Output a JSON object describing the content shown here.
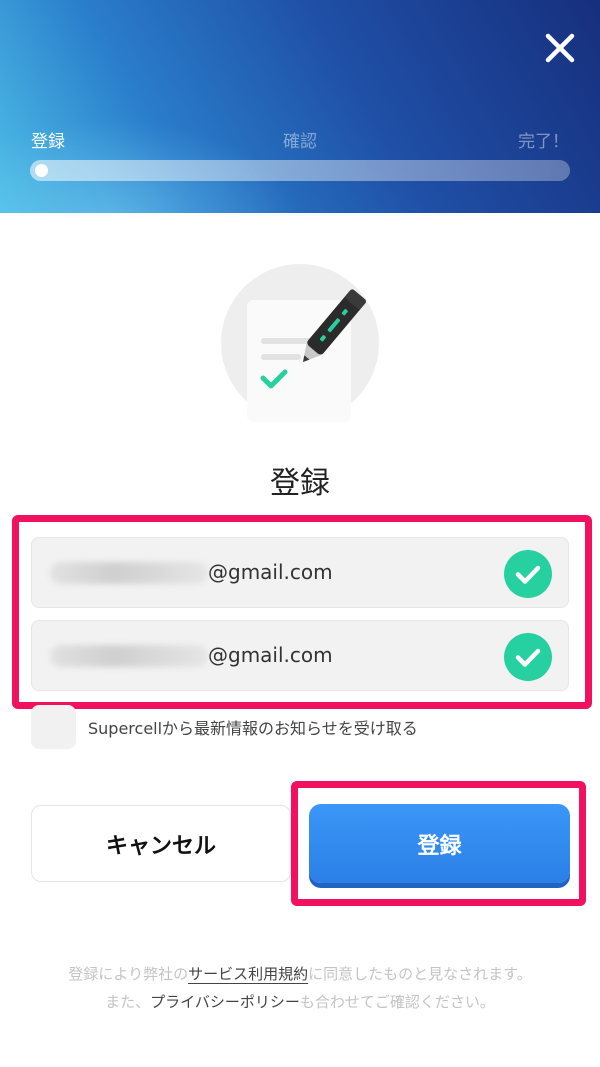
{
  "header": {
    "steps": [
      {
        "label": "登録",
        "active": true
      },
      {
        "label": "確認",
        "active": false
      },
      {
        "label": "完了！",
        "active": false
      }
    ],
    "close_icon": "close-icon",
    "progress_fraction": 0.0
  },
  "illustration_icon": "document-pen-check-icon",
  "title": "登録",
  "fields": [
    {
      "value_domain": "@gmail.com",
      "status_icon": "check-circle-icon",
      "status_color": "#27d0a0"
    },
    {
      "value_domain": "@gmail.com",
      "status_icon": "check-circle-icon",
      "status_color": "#27d0a0"
    }
  ],
  "newsletter": {
    "label": "Supercellから最新情報のお知らせを受け取る",
    "checked": false
  },
  "buttons": {
    "cancel": "キャンセル",
    "register": "登録"
  },
  "legal": {
    "prefix": "登録により弊社の",
    "terms_link": "サービス利用規約",
    "suffix": "に同意したものと見なされます。",
    "line2_prefix": "また、",
    "privacy_link": "プライバシーポリシー",
    "line2_suffix": "も合わせてご確認ください。"
  },
  "colors": {
    "highlight": "#f2115f",
    "primary_button": "#2b7fe6",
    "success": "#27d0a0"
  }
}
